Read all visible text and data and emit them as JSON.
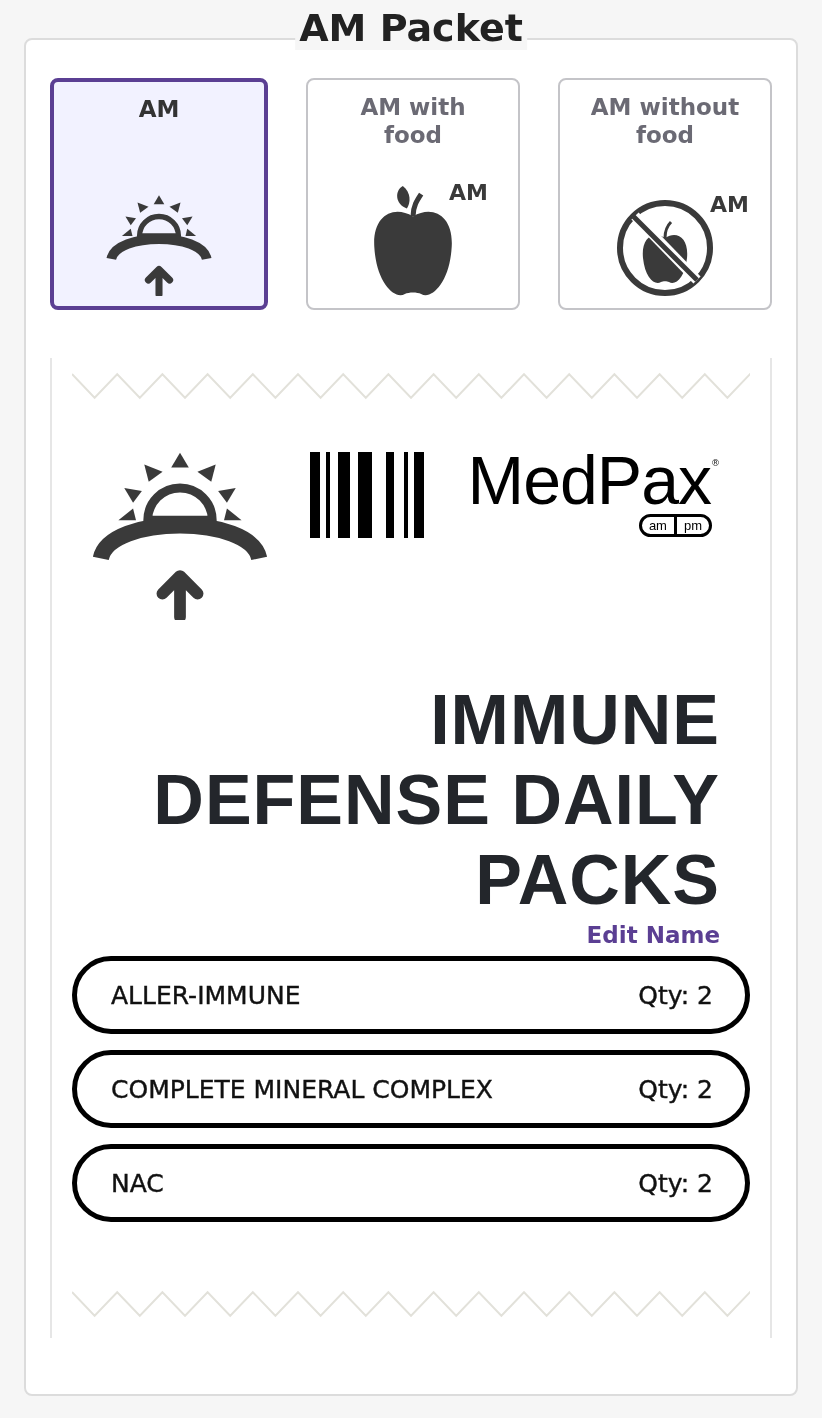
{
  "title": "AM Packet",
  "options": [
    {
      "label": "AM",
      "kind": "sunrise",
      "selected": true
    },
    {
      "label": "AM with food",
      "kind": "apple",
      "badge": "AM",
      "selected": false
    },
    {
      "label": "AM without food",
      "kind": "no-apple",
      "badge": "AM",
      "selected": false
    }
  ],
  "packet": {
    "brand": {
      "name": "MedPax",
      "mark": "®",
      "pill": [
        "am",
        "pm"
      ]
    },
    "name": "IMMUNE DEFENSE DAILY PACKS",
    "edit_link": "Edit Name",
    "items": [
      {
        "name": "ALLER-IMMUNE",
        "qty": "Qty: 2"
      },
      {
        "name": "COMPLETE MINERAL COMPLEX",
        "qty": "Qty: 2"
      },
      {
        "name": "NAC",
        "qty": "Qty: 2"
      }
    ]
  }
}
